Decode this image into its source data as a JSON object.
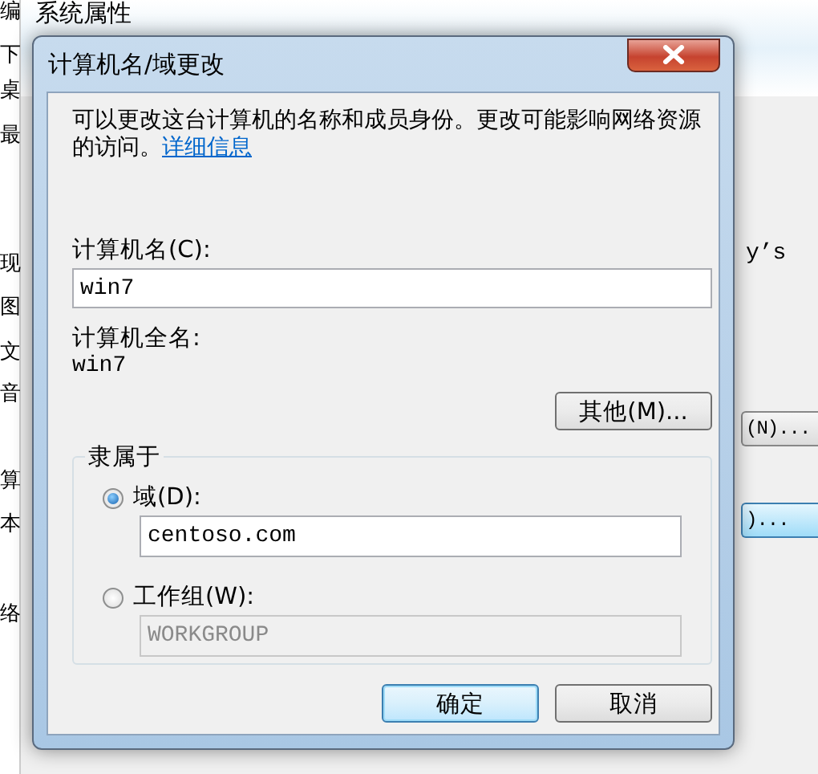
{
  "background_window": {
    "title": "系统属性",
    "left_edge_texts": [
      "编",
      "下",
      "桌",
      "最",
      "现",
      "图",
      "文",
      "音",
      "算",
      "本",
      "络"
    ],
    "right_edge_texts": [
      "y’s"
    ],
    "right_edge_buttons": [
      {
        "label": "(N)...",
        "selected": false
      },
      {
        "label": ")...",
        "selected": true
      }
    ]
  },
  "dialog": {
    "title": "计算机名/域更改",
    "description": "可以更改这台计算机的名称和成员身份。更改可能影响网络资源的访问。",
    "details_link": "详细信息",
    "computer_name_label": "计算机名(C):",
    "computer_name": "win7",
    "full_name_label": "计算机全名:",
    "full_name": "win7",
    "more_button": "其他(M)...",
    "member_of": {
      "title": "隶属于",
      "options": [
        {
          "label": "域(D):",
          "selected": true,
          "value": "centoso.com"
        },
        {
          "label": "工作组(W):",
          "selected": false,
          "value": "WORKGROUP"
        }
      ]
    },
    "buttons": [
      {
        "label": "确定",
        "default": true
      },
      {
        "label": "取消",
        "default": false
      }
    ]
  }
}
